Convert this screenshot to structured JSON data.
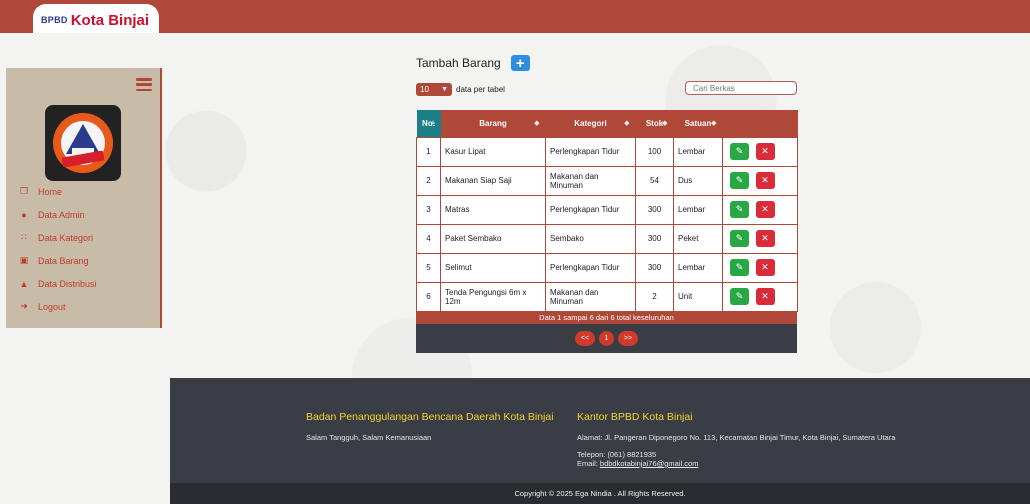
{
  "brand": {
    "prefix": "BPBD",
    "name": "Kota Binjai"
  },
  "sidebar": {
    "logo_text_top": "BADAN PENANGGULANGAN BENCANA DAERAH",
    "logo_text_mid": "BPBD",
    "logo_text_bottom": "KOTA BINJAI",
    "items": [
      {
        "label": "Home",
        "icon": "home-icon"
      },
      {
        "label": "Data Admin",
        "icon": "user-icon"
      },
      {
        "label": "Data Kategori",
        "icon": "users-icon"
      },
      {
        "label": "Data Barang",
        "icon": "laptop-icon"
      },
      {
        "label": "Data Distribusi",
        "icon": "user-tie-icon"
      },
      {
        "label": "Logout",
        "icon": "sign-out-icon"
      }
    ]
  },
  "main": {
    "title": "Tambah Barang",
    "add_symbol": "+",
    "perpage_value": "10",
    "perpage_label": "data per tabel",
    "search_placeholder": "Cari Berkas"
  },
  "table": {
    "headers": [
      "No.",
      "Barang",
      "Kategori",
      "Stok",
      "Satuan"
    ],
    "rows": [
      {
        "no": "1",
        "barang": "Kasur Lipat",
        "kategori": "Perlengkapan Tidur",
        "stok": "100",
        "satuan": "Lembar"
      },
      {
        "no": "2",
        "barang": "Makanan Siap Saji",
        "kategori": "Makanan dan Minuman",
        "stok": "54",
        "satuan": "Dus"
      },
      {
        "no": "3",
        "barang": "Matras",
        "kategori": "Perlengkapan Tidur",
        "stok": "300",
        "satuan": "Lembar"
      },
      {
        "no": "4",
        "barang": "Paket Sembako",
        "kategori": "Sembako",
        "stok": "300",
        "satuan": "Peket"
      },
      {
        "no": "5",
        "barang": "Selimut",
        "kategori": "Perlengkapan Tidur",
        "stok": "300",
        "satuan": "Lembar"
      },
      {
        "no": "6",
        "barang": "Tenda Pengungsi 6m x 12m",
        "kategori": "Makanan dan Minuman",
        "stok": "2",
        "satuan": "Unit"
      }
    ],
    "info": "Data 1 sampai 6 dari 6 total keseluruhan",
    "pager": {
      "prev": "<<",
      "page": "1",
      "next": ">>"
    }
  },
  "footer": {
    "col1_title": "Badan Penanggulangan Bencana Daerah Kota Binjai",
    "col1_text": "Salam Tangguh, Salam Kemanusiaan",
    "col2_title": "Kantor BPBD Kota Binjai",
    "address": "Alamat: Jl. Pangeran Diponegoro No. 113, Kecamatan Binjai Timur, Kota Binjai, Sumatera Utara",
    "phone": "Telepon: (061) 8821935",
    "email_label": "Email: ",
    "email": "bdbdkotabinjai76@gmail.com",
    "copyright": "Copyright © 2025 Ega Nindia . All Rights Reserved."
  },
  "colors": {
    "primary": "#b0483a",
    "sidebar_bg": "#c8bca8",
    "teal": "#1a7f86",
    "edit": "#2aa745",
    "delete": "#d92b3a",
    "footer_bg": "#3a3d44",
    "footer_title": "#f0d23a"
  }
}
